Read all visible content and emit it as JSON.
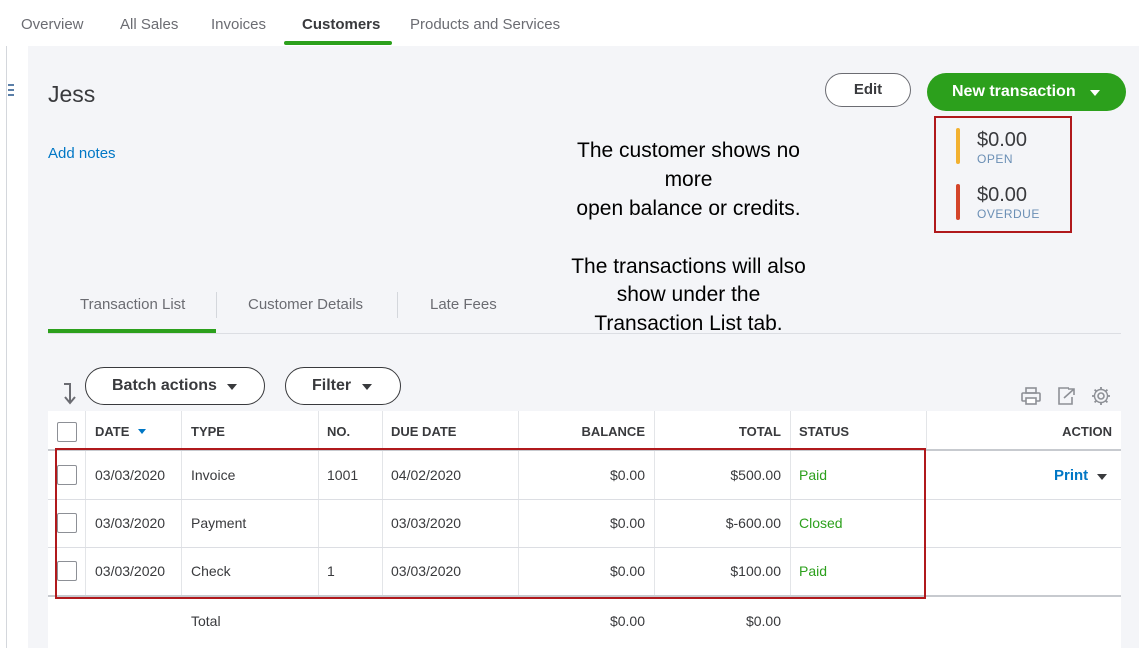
{
  "topnav": {
    "items": [
      "Overview",
      "All Sales",
      "Invoices",
      "Customers",
      "Products and Services"
    ],
    "active": "Customers"
  },
  "customer": {
    "name": "Jess",
    "add_notes_label": "Add notes"
  },
  "actions": {
    "edit_label": "Edit",
    "new_transaction_label": "New transaction"
  },
  "balances": {
    "open_amount": "$0.00",
    "open_label": "OPEN",
    "overdue_amount": "$0.00",
    "overdue_label": "OVERDUE",
    "open_color": "#f2b130",
    "overdue_color": "#d4452a"
  },
  "annotations": {
    "line1": "The customer shows no",
    "line2": "more",
    "line3": "open balance or credits.",
    "line4": "The transactions will also",
    "line5": "show under the",
    "line6": "Transaction List tab."
  },
  "subtabs": [
    "Transaction List",
    "Customer Details",
    "Late Fees"
  ],
  "toolbar": {
    "batch_actions_label": "Batch actions",
    "filter_label": "Filter",
    "icons": [
      "print-icon",
      "export-icon",
      "settings-gear-icon"
    ]
  },
  "table": {
    "columns": {
      "date": "DATE",
      "type": "TYPE",
      "no": "NO.",
      "due_date": "DUE DATE",
      "balance": "BALANCE",
      "total": "TOTAL",
      "status": "STATUS",
      "action": "ACTION"
    },
    "rows": [
      {
        "date": "03/03/2020",
        "type": "Invoice",
        "no": "1001",
        "due_date": "04/02/2020",
        "balance": "$0.00",
        "total": "$500.00",
        "status": "Paid",
        "action": "Print"
      },
      {
        "date": "03/03/2020",
        "type": "Payment",
        "no": "",
        "due_date": "03/03/2020",
        "balance": "$0.00",
        "total": "$-600.00",
        "status": "Closed",
        "action": ""
      },
      {
        "date": "03/03/2020",
        "type": "Check",
        "no": "1",
        "due_date": "03/03/2020",
        "balance": "$0.00",
        "total": "$100.00",
        "status": "Paid",
        "action": ""
      }
    ],
    "footer": {
      "label": "Total",
      "balance": "$0.00",
      "total": "$0.00"
    }
  },
  "colors": {
    "accent_green": "#2ca01c",
    "link_blue": "#0077c5",
    "highlight_red": "#b0191c"
  }
}
